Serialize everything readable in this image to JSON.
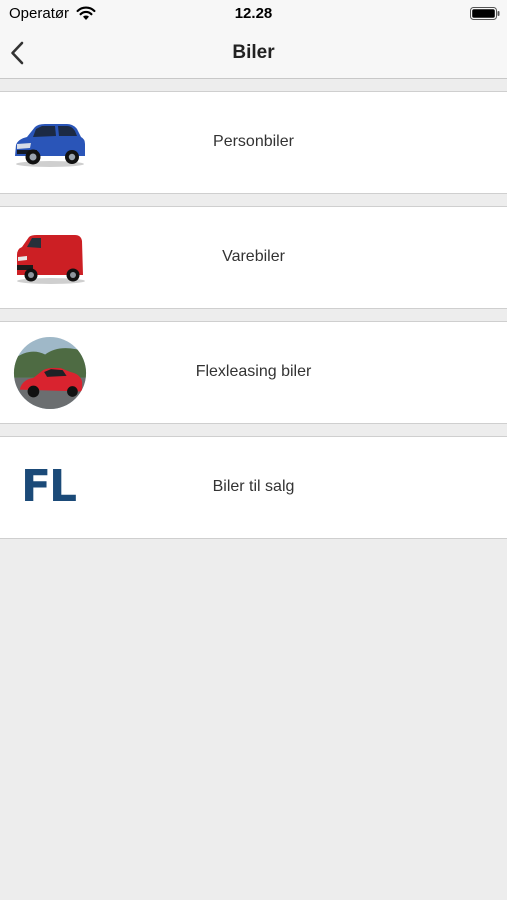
{
  "status_bar": {
    "carrier": "Operatør",
    "time": "12.28",
    "icons": [
      "wifi-icon",
      "battery-icon"
    ]
  },
  "nav": {
    "title": "Biler",
    "back_icon": "chevron-left-icon"
  },
  "items": [
    {
      "label": "Personbiler",
      "icon": "blue-suv-image"
    },
    {
      "label": "Varebiler",
      "icon": "red-van-image"
    },
    {
      "label": "Flexleasing biler",
      "icon": "red-sports-car-image"
    },
    {
      "label": "Biler til salg",
      "icon": "fl-logo",
      "logo_text": "FL"
    }
  ],
  "colors": {
    "background": "#ededed",
    "bar": "#f7f7f7",
    "logo_blue": "#1b4a78"
  }
}
